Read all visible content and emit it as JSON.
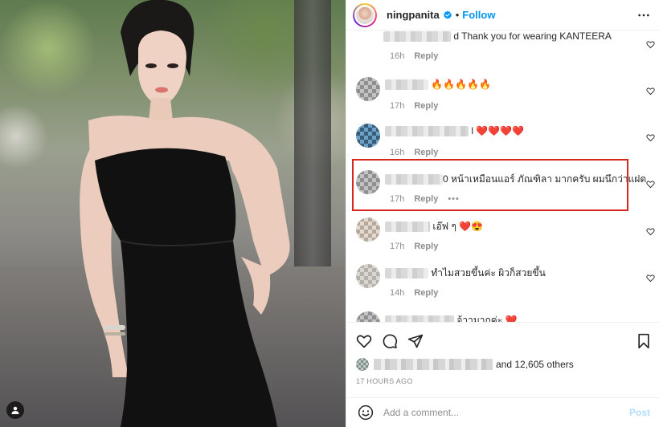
{
  "post": {
    "username": "ningpanita",
    "follow_label": "Follow",
    "separator": "•"
  },
  "comments": [
    {
      "text": "d Thank you for wearing KANTEERA",
      "time": "16h",
      "reply": "Reply",
      "emoji": ""
    },
    {
      "text": "",
      "time": "17h",
      "reply": "Reply",
      "emoji": "🔥🔥🔥🔥🔥"
    },
    {
      "text": "l",
      "time": "16h",
      "reply": "Reply",
      "emoji": "❤️❤️❤️❤️"
    },
    {
      "text": "0 หน้าเหมือนแอร์ ภัณฑิลา มากครับ ผมนึกว่าแฝด",
      "time": "17h",
      "reply": "Reply",
      "more": "•••"
    },
    {
      "text": "เอ๊ฟ ๆ",
      "time": "17h",
      "reply": "Reply",
      "emoji": "❤️😍"
    },
    {
      "text": "ทำไมสวยขึ้นค่ะ ผิวก็สวยขึ้น",
      "time": "14h",
      "reply": "Reply",
      "emoji": ""
    },
    {
      "text": "จ้าามากค่ะ",
      "time": "",
      "reply": "",
      "emoji": "❤️"
    }
  ],
  "likes": {
    "suffix": "and 12,605 others"
  },
  "timestamp": "17 HOURS AGO",
  "add_comment": {
    "placeholder": "Add a comment...",
    "post_label": "Post"
  },
  "colors": {
    "link_blue": "#0095f6",
    "highlight_red": "#d9261c",
    "muted": "#8e8e8e",
    "post_disabled": "#b2dffc"
  }
}
